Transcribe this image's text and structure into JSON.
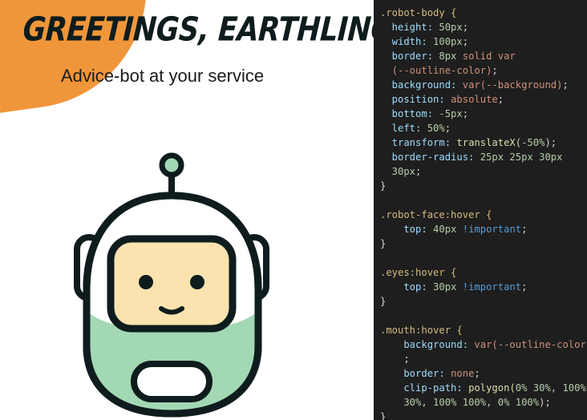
{
  "preview": {
    "title": "Greetings, Earthling!",
    "subtitle": "Advice-bot at your service",
    "colors": {
      "blob": "#f0963a",
      "outline": "#0f1c1d",
      "face": "#fbe3b0",
      "body": "#a3d8b5",
      "antenna_tip": "#a3d8b5"
    }
  },
  "code": {
    "lines": [
      [
        {
          "t": ".robot-body {",
          "c": "sel"
        }
      ],
      [
        {
          "t": "  height: ",
          "c": "prop"
        },
        {
          "t": "50px",
          "c": "num"
        },
        {
          "t": ";",
          "c": "punc"
        }
      ],
      [
        {
          "t": "  width: ",
          "c": "prop"
        },
        {
          "t": "100px",
          "c": "num"
        },
        {
          "t": ";",
          "c": "punc"
        }
      ],
      [
        {
          "t": "  border: ",
          "c": "prop"
        },
        {
          "t": "8px",
          "c": "num"
        },
        {
          "t": " solid var",
          "c": "val"
        }
      ],
      [
        {
          "t": "  (--outline-color)",
          "c": "val"
        },
        {
          "t": ";",
          "c": "punc"
        }
      ],
      [
        {
          "t": "  background: ",
          "c": "prop"
        },
        {
          "t": "var(--background)",
          "c": "val"
        },
        {
          "t": ";",
          "c": "punc"
        }
      ],
      [
        {
          "t": "  position: ",
          "c": "prop"
        },
        {
          "t": "absolute",
          "c": "val"
        },
        {
          "t": ";",
          "c": "punc"
        }
      ],
      [
        {
          "t": "  bottom: ",
          "c": "prop"
        },
        {
          "t": "-5px",
          "c": "num"
        },
        {
          "t": ";",
          "c": "punc"
        }
      ],
      [
        {
          "t": "  left: ",
          "c": "prop"
        },
        {
          "t": "50%",
          "c": "num"
        },
        {
          "t": ";",
          "c": "punc"
        }
      ],
      [
        {
          "t": "  transform: ",
          "c": "prop"
        },
        {
          "t": "translateX(",
          "c": "fn"
        },
        {
          "t": "-50%",
          "c": "num"
        },
        {
          "t": ");",
          "c": "punc"
        }
      ],
      [
        {
          "t": "  border-radius: ",
          "c": "prop"
        },
        {
          "t": "25px 25px 30px",
          "c": "num"
        }
      ],
      [
        {
          "t": "  30px",
          "c": "num"
        },
        {
          "t": ";",
          "c": "punc"
        }
      ],
      [
        {
          "t": "}",
          "c": "punc"
        }
      ],
      [
        {
          "t": "",
          "c": "punc"
        }
      ],
      [
        {
          "t": ".robot-face:hover {",
          "c": "sel"
        }
      ],
      [
        {
          "t": "    top: ",
          "c": "prop"
        },
        {
          "t": "40px",
          "c": "num"
        },
        {
          "t": " !important",
          "c": "imp"
        },
        {
          "t": ";",
          "c": "punc"
        }
      ],
      [
        {
          "t": "}",
          "c": "punc"
        }
      ],
      [
        {
          "t": "",
          "c": "punc"
        }
      ],
      [
        {
          "t": ".eyes:hover {",
          "c": "sel"
        }
      ],
      [
        {
          "t": "    top: ",
          "c": "prop"
        },
        {
          "t": "30px",
          "c": "num"
        },
        {
          "t": " !important",
          "c": "imp"
        },
        {
          "t": ";",
          "c": "punc"
        }
      ],
      [
        {
          "t": "}",
          "c": "punc"
        }
      ],
      [
        {
          "t": "",
          "c": "punc"
        }
      ],
      [
        {
          "t": ".mouth:hover {",
          "c": "sel"
        }
      ],
      [
        {
          "t": "    background: ",
          "c": "prop"
        },
        {
          "t": "var(--outline-color)",
          "c": "val"
        }
      ],
      [
        {
          "t": "    ;",
          "c": "punc"
        }
      ],
      [
        {
          "t": "    border: ",
          "c": "prop"
        },
        {
          "t": "none",
          "c": "val"
        },
        {
          "t": ";",
          "c": "punc"
        }
      ],
      [
        {
          "t": "    clip-path: ",
          "c": "prop"
        },
        {
          "t": "polygon(",
          "c": "fn"
        },
        {
          "t": "0% 30%, 100%",
          "c": "num"
        }
      ],
      [
        {
          "t": "    30%, 100% 100%, 0% 100%",
          "c": "num"
        },
        {
          "t": ");",
          "c": "punc"
        }
      ],
      [
        {
          "t": "}",
          "c": "punc"
        }
      ]
    ]
  }
}
